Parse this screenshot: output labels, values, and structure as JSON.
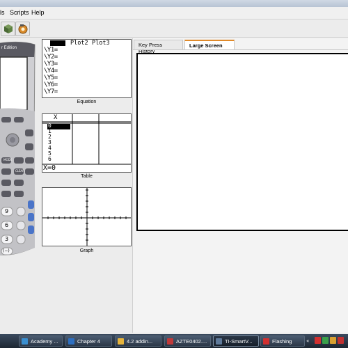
{
  "menubar": {
    "items": [
      "ls",
      "Scripts",
      "Help"
    ]
  },
  "calculator": {
    "edition_text": "r Edition",
    "keys": [
      "MODE",
      "CLEAR",
      "9",
      "6",
      "3",
      "(−)"
    ]
  },
  "equation": {
    "selected_text": "",
    "plots": [
      "Plot2",
      "Plot3"
    ],
    "rows": [
      "\\Y1=",
      "\\Y2=",
      "\\Y3=",
      "\\Y4=",
      "\\Y5=",
      "\\Y6=",
      "\\Y7="
    ],
    "caption": "Equation"
  },
  "table": {
    "header_x": "X",
    "x_values": [
      "0",
      "1",
      "2",
      "3",
      "4",
      "5",
      "6"
    ],
    "footer": "X=0",
    "caption": "Table"
  },
  "graph": {
    "caption": "Graph"
  },
  "right_panel": {
    "tabs": [
      "Key Press History",
      "Large Screen"
    ],
    "active_tab": "Large Screen"
  },
  "taskbar": {
    "items": [
      {
        "label": "Academy ...",
        "icon_color": "#3a8fd0"
      },
      {
        "label": "Chapter 4",
        "icon_color": "#2e6fc0"
      },
      {
        "label": "4.2 addin...",
        "icon_color": "#e6b43c"
      },
      {
        "label": "AZTE0402....",
        "icon_color": "#c03a3a"
      },
      {
        "label": "TI-SmartV...",
        "icon_color": "#5f7a9a"
      },
      {
        "label": "Flashing",
        "icon_color": "#d23030"
      }
    ],
    "active_index": 4
  }
}
